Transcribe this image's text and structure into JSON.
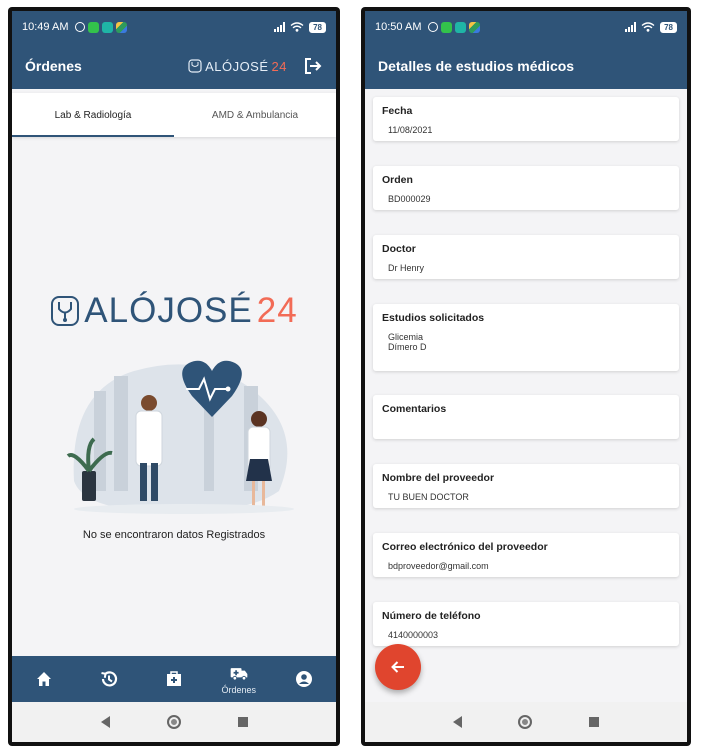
{
  "left_screen": {
    "status_time": "10:49 AM",
    "battery": "78",
    "app_title": "Órdenes",
    "brand_part1": "ALÓJOSÉ",
    "brand_part2": "24",
    "tabs": [
      {
        "label": "Lab & Radiología",
        "active": true
      },
      {
        "label": "AMD & Ambulancia",
        "active": false
      }
    ],
    "logo_part1": "ALÓJOSÉ",
    "logo_part2": "24",
    "empty_message": "No se encontraron datos Registrados",
    "bottom_nav": [
      {
        "icon": "home-icon",
        "label": ""
      },
      {
        "icon": "history-icon",
        "label": ""
      },
      {
        "icon": "medical-case-icon",
        "label": ""
      },
      {
        "icon": "ambulance-icon",
        "label": "Órdenes"
      },
      {
        "icon": "account-icon",
        "label": ""
      }
    ]
  },
  "right_screen": {
    "status_time": "10:50 AM",
    "battery": "78",
    "app_title": "Detalles de estudios médicos",
    "fields": [
      {
        "label": "Fecha",
        "value": "11/08/2021"
      },
      {
        "label": "Orden",
        "value": "BD000029"
      },
      {
        "label": "Doctor",
        "value": "Dr Henry"
      },
      {
        "label": "Estudios solicitados",
        "values": [
          "Glicemia",
          "Dímero D"
        ]
      },
      {
        "label": "Comentarios",
        "value": ""
      },
      {
        "label": "Nombre del proveedor",
        "value": "TU BUEN DOCTOR"
      },
      {
        "label": "Correo electrónico del proveedor",
        "value": "bdproveedor@gmail.com"
      },
      {
        "label": "Número de teléfono",
        "value": "4140000003"
      }
    ]
  },
  "colors": {
    "primary": "#2f5478",
    "accent": "#f26b56",
    "fab": "#e0452e"
  }
}
